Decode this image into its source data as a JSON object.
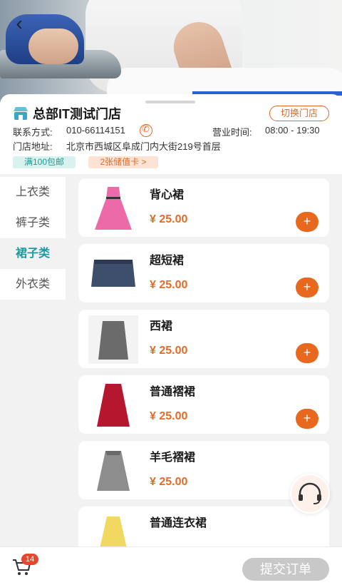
{
  "store": {
    "name": "总部IT测试门店",
    "switch_label": "切换门店",
    "contact_label": "联系方式:",
    "phone": "010-66114151",
    "hours_label": "营业时间:",
    "hours": "08:00 - 19:30",
    "address_label": "门店地址:",
    "address": "北京市西城区阜成门内大街219号首层",
    "tag_free": "满100包邮",
    "tag_card": "2张储值卡 >"
  },
  "categories": [
    {
      "label": "上衣类",
      "active": false
    },
    {
      "label": "裤子类",
      "active": false
    },
    {
      "label": "裙子类",
      "active": true
    },
    {
      "label": "外衣类",
      "active": false
    }
  ],
  "products": [
    {
      "name": "背心裙",
      "price": "¥ 25.00"
    },
    {
      "name": "超短裙",
      "price": "¥ 25.00"
    },
    {
      "name": "西裙",
      "price": "¥ 25.00"
    },
    {
      "name": "普通褶裙",
      "price": "¥ 25.00"
    },
    {
      "name": "羊毛褶裙",
      "price": "¥ 25.00"
    },
    {
      "name": "普通连衣裙",
      "price": ""
    }
  ],
  "add_label": "+",
  "cart": {
    "count": "14"
  },
  "submit_label": "提交订单",
  "colors": {
    "accent": "#e8681e",
    "teal": "#1a9aa0"
  }
}
